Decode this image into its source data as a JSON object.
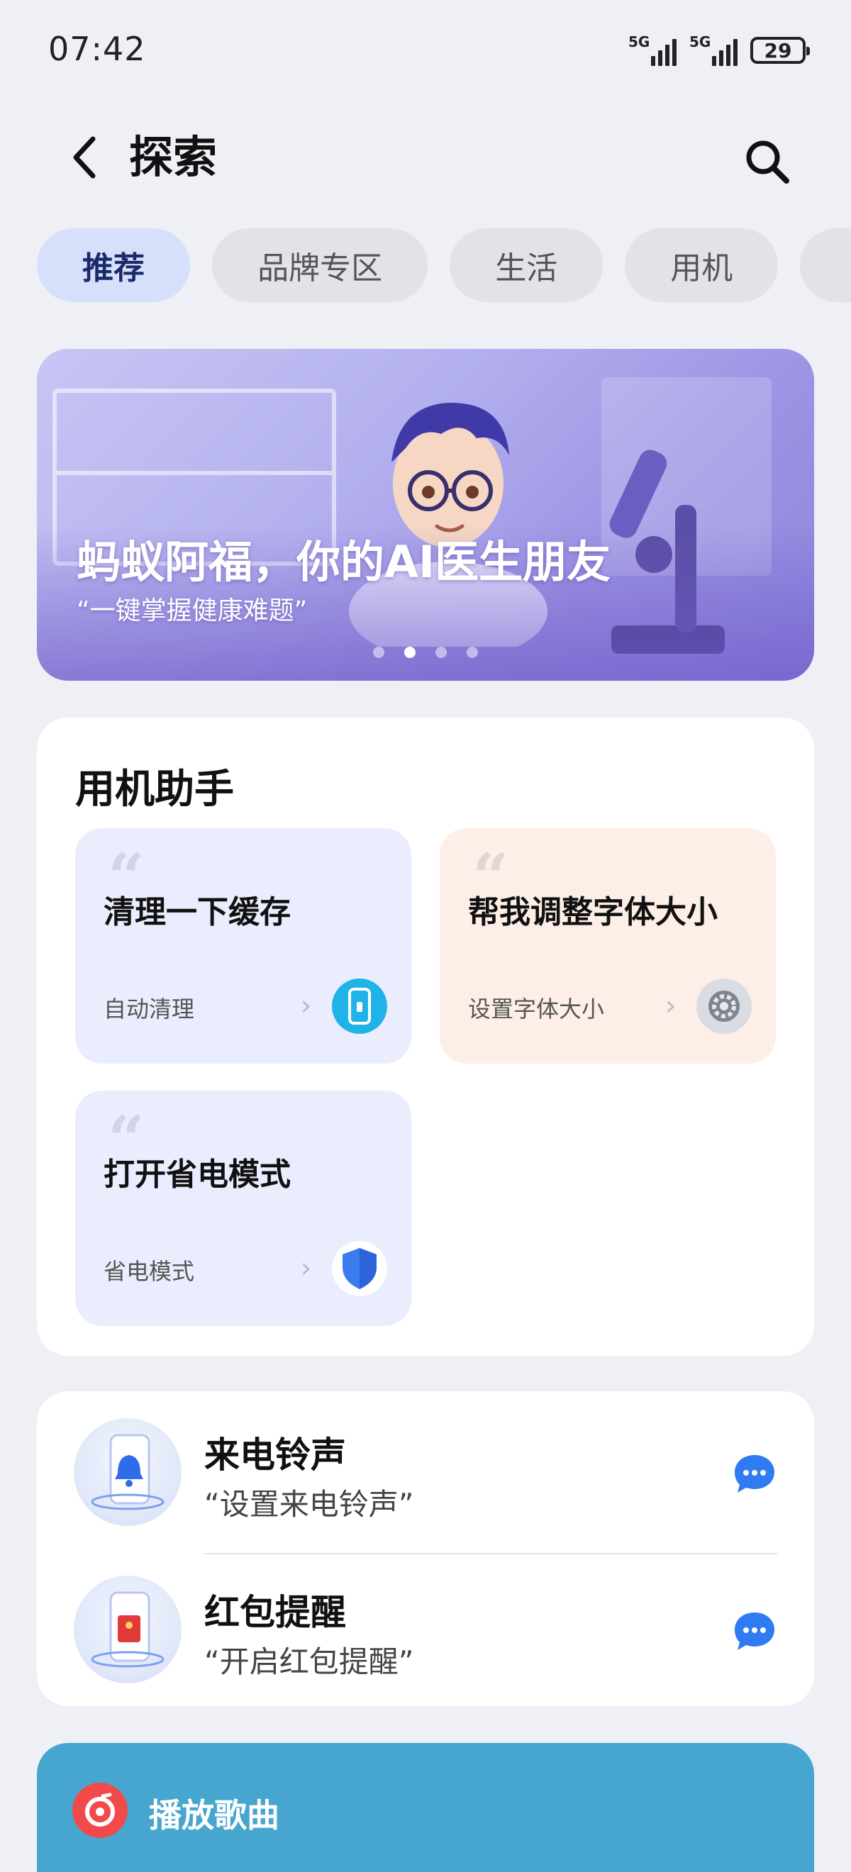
{
  "status": {
    "time": "07:42",
    "sim1": "5G",
    "sim2": "5G",
    "battery": "29"
  },
  "header": {
    "title": "探索",
    "back_icon": "chevron-left-icon",
    "search_icon": "search-icon"
  },
  "tabs": [
    {
      "label": "推荐",
      "active": true
    },
    {
      "label": "品牌专区",
      "active": false
    },
    {
      "label": "生活",
      "active": false
    },
    {
      "label": "用机",
      "active": false
    },
    {
      "label": "",
      "active": false
    }
  ],
  "banner": {
    "title": "蚂蚁阿福，你的AI医生朋友",
    "subtitle": "“一键掌握健康难题”",
    "page_count": 4,
    "active_page": 2
  },
  "assistant": {
    "title": "用机助手",
    "tiles": [
      {
        "title": "清理一下缓存",
        "action": "自动清理",
        "icon": "phone-clean-icon",
        "icon_color": "#1fb3e8"
      },
      {
        "title": "帮我调整字体大小",
        "action": "设置字体大小",
        "icon": "settings-gear-icon",
        "icon_color": "#8a8f9a"
      },
      {
        "title": "打开省电模式",
        "action": "省电模式",
        "icon": "shield-icon",
        "icon_color": "#3a7bf0"
      }
    ]
  },
  "shortcuts": [
    {
      "title": "来电铃声",
      "subtitle": "“设置来电铃声”",
      "icon": "bell-phone-icon",
      "chat_icon": "chat-bubble-icon"
    },
    {
      "title": "红包提醒",
      "subtitle": "“开启红包提醒”",
      "icon": "red-envelope-phone-icon",
      "chat_icon": "chat-bubble-icon"
    }
  ],
  "music": {
    "label": "播放歌曲",
    "icon": "music-app-icon"
  },
  "colors": {
    "accent_blue": "#2f7bf2",
    "tab_active_bg": "#d6e0fb",
    "music_card": "#47a6cf"
  }
}
